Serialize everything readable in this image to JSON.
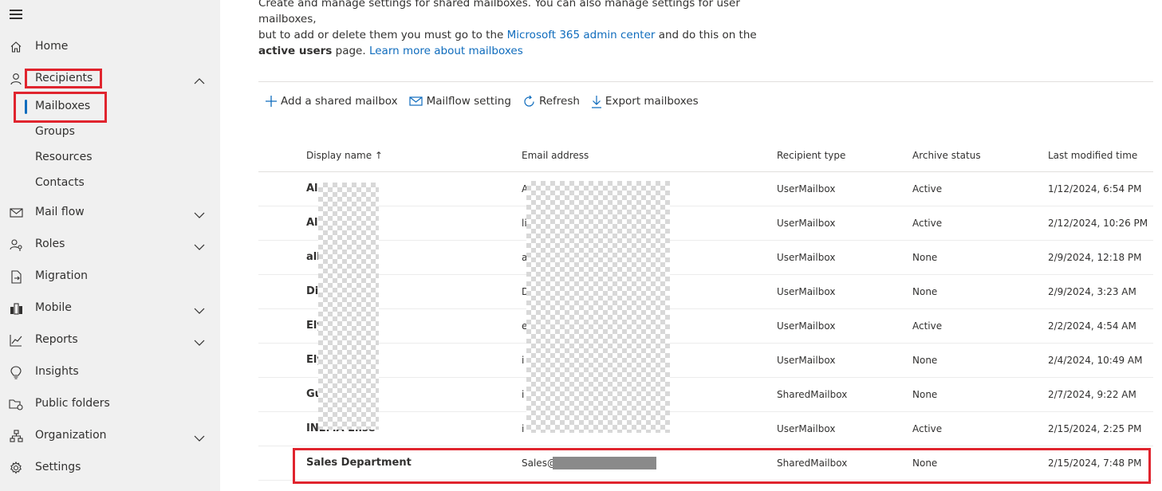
{
  "sidebar": {
    "home": "Home",
    "recipients": "Recipients",
    "sub_items": [
      "Mailboxes",
      "Groups",
      "Resources",
      "Contacts"
    ],
    "mail_flow": "Mail flow",
    "roles": "Roles",
    "migration": "Migration",
    "mobile": "Mobile",
    "reports": "Reports",
    "insights": "Insights",
    "public_folders": "Public folders",
    "organization": "Organization",
    "settings": "Settings"
  },
  "description": {
    "line1": "Create and manage settings for shared mailboxes. You can also manage settings for user mailboxes,",
    "line2_pre": "but to add or delete them you must go to the ",
    "admin_link": "Microsoft 365 admin center",
    "line2_post": " and do this on the",
    "bold": "active users",
    "line3_post": " page. ",
    "learn_link": "Learn more about mailboxes"
  },
  "toolbar": {
    "add": "Add a shared mailbox",
    "mailflow": "Mailflow setting",
    "refresh": "Refresh",
    "export": "Export mailboxes"
  },
  "table": {
    "headers": {
      "name": "Display name",
      "email": "Email address",
      "type": "Recipient type",
      "archive": "Archive status",
      "modified": "Last modified time"
    },
    "rows": [
      {
        "name": "Al",
        "email": "A",
        "type": "UserMailbox",
        "archive": "Active",
        "modified": "1/12/2024, 6:54 PM"
      },
      {
        "name": "All",
        "email": "li",
        "type": "UserMailbox",
        "archive": "Active",
        "modified": "2/12/2024, 10:26 PM"
      },
      {
        "name": "all",
        "email": "a",
        "type": "UserMailbox",
        "archive": "None",
        "modified": "2/9/2024, 12:18 PM"
      },
      {
        "name": "Di",
        "email": "D",
        "type": "UserMailbox",
        "archive": "None",
        "modified": "2/9/2024, 3:23 AM"
      },
      {
        "name": "Ely",
        "email": "e",
        "type": "UserMailbox",
        "archive": "Active",
        "modified": "2/2/2024, 4:54 AM"
      },
      {
        "name": "Ely",
        "email": "i",
        "type": "UserMailbox",
        "archive": "None",
        "modified": "2/4/2024, 10:49 AM"
      },
      {
        "name": "Gu",
        "email": "i",
        "type": "SharedMailbox",
        "archive": "None",
        "modified": "2/7/2024, 9:22 AM"
      },
      {
        "name": "INEMA Elise",
        "email": "i",
        "type": "UserMailbox",
        "archive": "Active",
        "modified": "2/15/2024, 2:25 PM"
      },
      {
        "name": "Sales Department",
        "email": "Sales@",
        "type": "SharedMailbox",
        "archive": "None",
        "modified": "2/15/2024, 7:48 PM"
      }
    ]
  },
  "colors": {
    "accent": "#0f6cbd",
    "highlight": "#e0242e",
    "sidebar_bg": "#f0f0f0"
  }
}
